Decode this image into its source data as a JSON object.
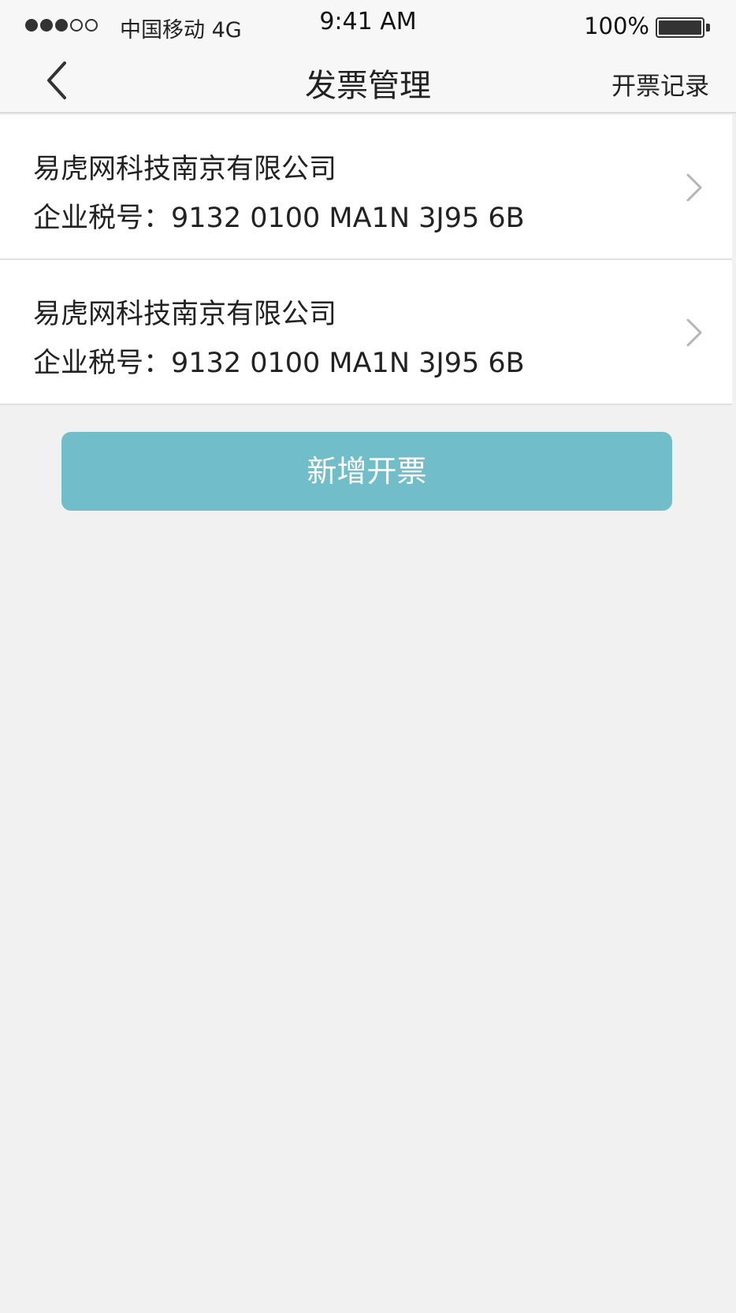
{
  "status_bar": {
    "carrier": "中国移动 4G",
    "time": "9:41 AM",
    "battery_percent": "100%"
  },
  "nav": {
    "title": "发票管理",
    "right_action": "开票记录"
  },
  "companies": [
    {
      "name": "易虎网科技南京有限公司",
      "tax_label": "企业税号：",
      "tax_id": "9132 0100 MA1N 3J95 6B"
    },
    {
      "name": "易虎网科技南京有限公司",
      "tax_label": "企业税号：",
      "tax_id": "9132 0100 MA1N 3J95 6B"
    }
  ],
  "add_button_label": "新增开票",
  "colors": {
    "accent": "#72bdca",
    "background": "#f1f1f2",
    "bar": "#f7f7f8"
  }
}
